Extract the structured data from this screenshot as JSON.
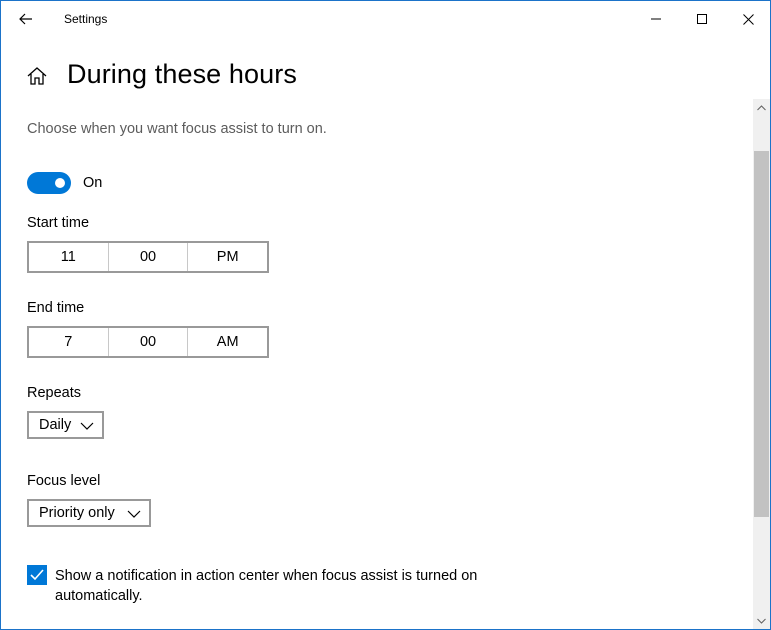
{
  "window": {
    "title": "Settings"
  },
  "header": {
    "title": "During these hours"
  },
  "description": "Choose when you want focus assist to turn on.",
  "toggle": {
    "state_label": "On",
    "enabled": true
  },
  "start_time": {
    "label": "Start time",
    "hour": "11",
    "minute": "00",
    "period": "PM"
  },
  "end_time": {
    "label": "End time",
    "hour": "7",
    "minute": "00",
    "period": "AM"
  },
  "repeats": {
    "label": "Repeats",
    "value": "Daily"
  },
  "focus_level": {
    "label": "Focus level",
    "value": "Priority only"
  },
  "notification": {
    "checked": true,
    "text": "Show a notification in action center when focus assist is turned on automatically."
  },
  "colors": {
    "accent": "#0078d7",
    "window_border": "#1b73c9",
    "muted_text": "#5c5c5c"
  },
  "icons": [
    "back-arrow-icon",
    "minimize-icon",
    "maximize-icon",
    "close-icon",
    "home-icon",
    "chevron-down-icon",
    "checkmark-icon",
    "scroll-up-arrow-icon",
    "scroll-down-arrow-icon"
  ]
}
